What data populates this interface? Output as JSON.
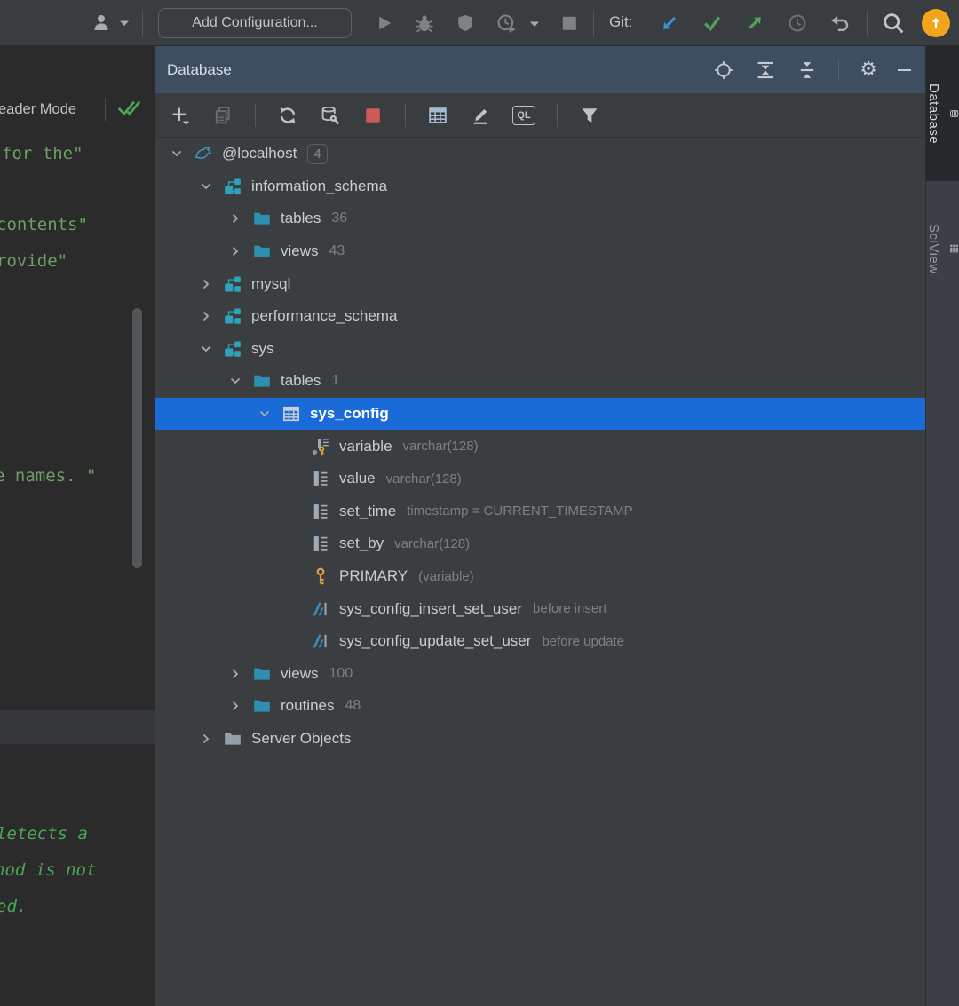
{
  "colors": {
    "selection_blue": "#1A6BD8",
    "tool_header_blue": "#3C4E60",
    "folder_teal": "#2F8FB0",
    "folder_gray": "#93A0AA",
    "schema_teal": "#2FA3BC",
    "mysql_blue": "#3F9AD1",
    "key_gold": "#E0A33B",
    "trigger_blue": "#3896D2",
    "column_gray": "#9DACB9",
    "table_gray": "#C9CFD6",
    "git_green": "#4DA356",
    "git_update_blue": "#3894D0",
    "update_orange": "#F2A41C",
    "stop_red": "#CE5A57",
    "string_green": "#6F9E68",
    "comment_green": "#4CA656"
  },
  "top_toolbar": {
    "add_configuration": "Add Configuration...",
    "git_label": "Git:",
    "icons": [
      "user-icon",
      "run-icon",
      "debug-icon",
      "coverage-icon",
      "profiler-icon",
      "stop-icon",
      "git-update-icon",
      "git-commit-icon",
      "git-push-icon",
      "git-history-icon",
      "git-rollback-icon",
      "search-icon",
      "update-available-icon"
    ]
  },
  "editor": {
    "reader_mode_label": "eader Mode",
    "code_strings": [
      "for the\"",
      "contents\"",
      "rovide\"",
      "e names. \""
    ],
    "code_comments": [
      "letects a",
      "hod is not",
      "ed."
    ]
  },
  "database_panel": {
    "title": "Database",
    "header_icons": [
      "locate-icon",
      "expand-all-icon",
      "collapse-all-icon",
      "gear-icon",
      "hide-icon"
    ],
    "toolbar_icons": [
      "add-icon",
      "copy-icon",
      "refresh-icon",
      "datasource-properties-icon",
      "stop-process-icon",
      "data-view-icon",
      "edit-icon",
      "ql-console-icon",
      "filter-icon"
    ],
    "ql_label": "QL",
    "tree": [
      {
        "level": 0,
        "chevron": "down",
        "icon": "mysql-icon",
        "label": "@localhost",
        "badge": "4"
      },
      {
        "level": 1,
        "chevron": "down",
        "icon": "schema-icon",
        "label": "information_schema"
      },
      {
        "level": 2,
        "chevron": "right",
        "icon": "folder-icon",
        "label": "tables",
        "count": "36"
      },
      {
        "level": 2,
        "chevron": "right",
        "icon": "folder-icon",
        "label": "views",
        "count": "43"
      },
      {
        "level": 1,
        "chevron": "right",
        "icon": "schema-icon",
        "label": "mysql"
      },
      {
        "level": 1,
        "chevron": "right",
        "icon": "schema-icon",
        "label": "performance_schema"
      },
      {
        "level": 1,
        "chevron": "down",
        "icon": "schema-icon",
        "label": "sys"
      },
      {
        "level": 2,
        "chevron": "down",
        "icon": "folder-icon",
        "label": "tables",
        "count": "1"
      },
      {
        "level": 3,
        "chevron": "down",
        "icon": "table-icon",
        "label": "sys_config",
        "selected": true
      },
      {
        "level": 4,
        "chevron": "none",
        "icon": "column-key-icon",
        "label": "variable",
        "meta": "varchar(128)"
      },
      {
        "level": 4,
        "chevron": "none",
        "icon": "column-icon",
        "label": "value",
        "meta": "varchar(128)"
      },
      {
        "level": 4,
        "chevron": "none",
        "icon": "column-icon",
        "label": "set_time",
        "meta": "timestamp = CURRENT_TIMESTAMP"
      },
      {
        "level": 4,
        "chevron": "none",
        "icon": "column-icon",
        "label": "set_by",
        "meta": "varchar(128)"
      },
      {
        "level": 4,
        "chevron": "none",
        "icon": "key-icon",
        "label": "PRIMARY",
        "meta": "(variable)"
      },
      {
        "level": 4,
        "chevron": "none",
        "icon": "trigger-icon",
        "label": "sys_config_insert_set_user",
        "meta": "before insert"
      },
      {
        "level": 4,
        "chevron": "none",
        "icon": "trigger-icon",
        "label": "sys_config_update_set_user",
        "meta": "before update"
      },
      {
        "level": 2,
        "chevron": "right",
        "icon": "folder-icon",
        "label": "views",
        "count": "100"
      },
      {
        "level": 2,
        "chevron": "right",
        "icon": "folder-icon",
        "label": "routines",
        "count": "48"
      },
      {
        "level": 1,
        "chevron": "right",
        "icon": "folder-gray-icon",
        "label": "Server Objects"
      }
    ]
  },
  "right_stripe": {
    "tabs": [
      {
        "label": "Database",
        "icon": "database-icon",
        "active": true
      },
      {
        "label": "SciView",
        "icon": "grid-icon",
        "active": false
      }
    ]
  }
}
